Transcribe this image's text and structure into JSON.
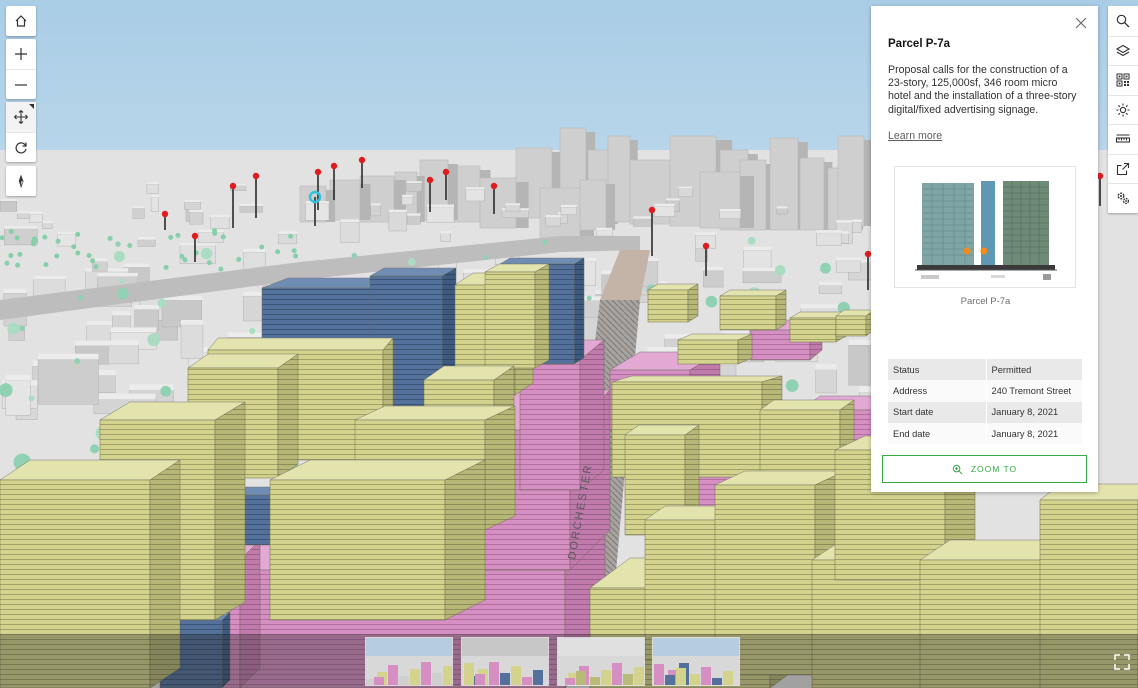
{
  "popup": {
    "title": "Parcel P-7a",
    "description": "Proposal calls for the construction of a 23-story, 125,000sf, 346 room micro hotel and the installation of a three-story digital/fixed advertising signage.",
    "link_label": "Learn more",
    "image_caption": "Parcel P-7a",
    "attributes": [
      {
        "key": "Status",
        "value": "Permitted"
      },
      {
        "key": "Address",
        "value": "240 Tremont Street"
      },
      {
        "key": "Start date",
        "value": "January 8, 2021"
      },
      {
        "key": "End date",
        "value": "January 8, 2021"
      }
    ],
    "zoom_button_label": "ZOOM TO"
  },
  "map": {
    "street_label": "DORCHESTER"
  },
  "icons": {
    "left_tools": [
      "home-icon",
      "plus-icon",
      "minus-icon",
      "pan-icon",
      "rotate-icon",
      "compass-icon"
    ],
    "right_tools": [
      "search-icon",
      "layers-icon",
      "qr-code-icon",
      "daylight-icon",
      "measure-icon",
      "share-icon",
      "settings-icon"
    ],
    "close": "close-icon",
    "zoom": "zoom-icon",
    "fullscreen": "fullscreen-icon"
  },
  "colors": {
    "accent_green": "#35ac46",
    "proposal_yellow": "#d3d38d",
    "proposal_pink": "#d58fc2",
    "proposal_blue": "#53719a",
    "pin_red": "#e01d1d",
    "selection_cyan": "#2bc5e0"
  },
  "slides": [
    "slide-1",
    "slide-2",
    "slide-3",
    "slide-4"
  ]
}
